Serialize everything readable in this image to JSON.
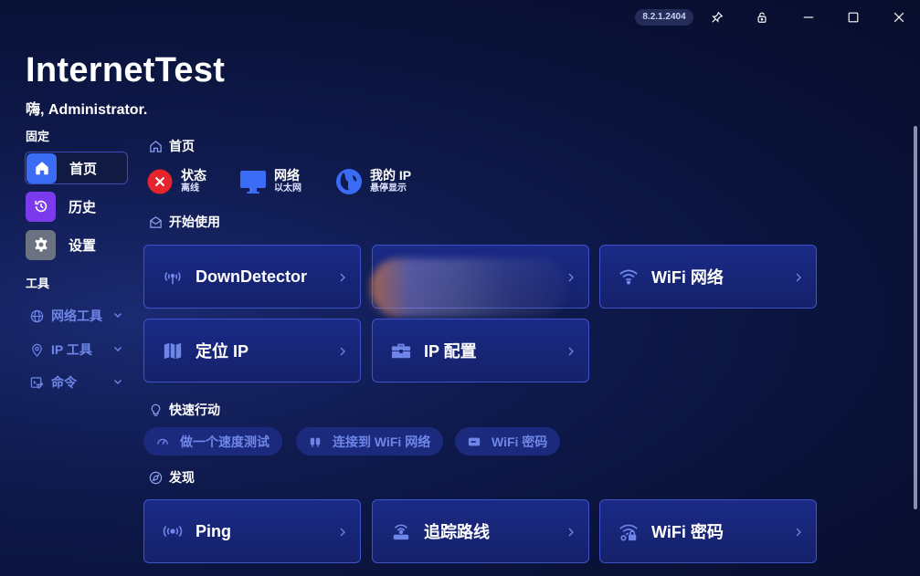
{
  "titlebar": {
    "version": "8.2.1.2404"
  },
  "app": {
    "title": "InternetTest",
    "greeting": "嗨, Administrator."
  },
  "sidebar": {
    "pinned_label": "固定",
    "items": [
      {
        "label": "首页",
        "icon": "home-icon",
        "color": "#3b6cf5"
      },
      {
        "label": "历史",
        "icon": "history-icon",
        "color": "#7c3aed"
      },
      {
        "label": "设置",
        "icon": "gear-icon",
        "color": "#6b7280"
      }
    ],
    "tools_label": "工具",
    "tools": [
      {
        "label": "网络工具",
        "icon": "globe-icon"
      },
      {
        "label": "IP 工具",
        "icon": "location-pin-icon"
      },
      {
        "label": "命令",
        "icon": "command-icon"
      }
    ]
  },
  "main": {
    "breadcrumb": "首页",
    "status": [
      {
        "title": "状态",
        "subtitle": "离线",
        "icon": "offline-x-icon"
      },
      {
        "title": "网络",
        "subtitle": "以太网",
        "icon": "monitor-icon"
      },
      {
        "title": "我的 IP",
        "subtitle": "悬停显示",
        "icon": "globe-person-icon"
      }
    ],
    "get_started": {
      "header": "开始使用",
      "cards": [
        {
          "label": "DownDetector",
          "icon": "wifi-signal-icon"
        },
        {
          "label": "",
          "icon": "blurred-icon"
        },
        {
          "label": "WiFi 网络",
          "icon": "wifi-icon"
        },
        {
          "label": "定位 IP",
          "icon": "map-icon"
        },
        {
          "label": "IP 配置",
          "icon": "toolbox-icon"
        }
      ]
    },
    "quick_actions": {
      "header": "快速行动",
      "items": [
        {
          "label": "做一个速度测试",
          "icon": "speedometer-icon"
        },
        {
          "label": "连接到 WiFi 网络",
          "icon": "plug-icon"
        },
        {
          "label": "WiFi 密码",
          "icon": "key-card-icon"
        }
      ]
    },
    "discover": {
      "header": "发现",
      "cards": [
        {
          "label": "Ping",
          "icon": "broadcast-icon"
        },
        {
          "label": "追踪路线",
          "icon": "router-icon"
        },
        {
          "label": "WiFi 密码",
          "icon": "wifi-lock-icon"
        }
      ]
    }
  },
  "colors": {
    "accent": "#3f53c9",
    "card_bg": "#1a2a86",
    "link": "#6f86e8",
    "offline": "#e5242b"
  }
}
